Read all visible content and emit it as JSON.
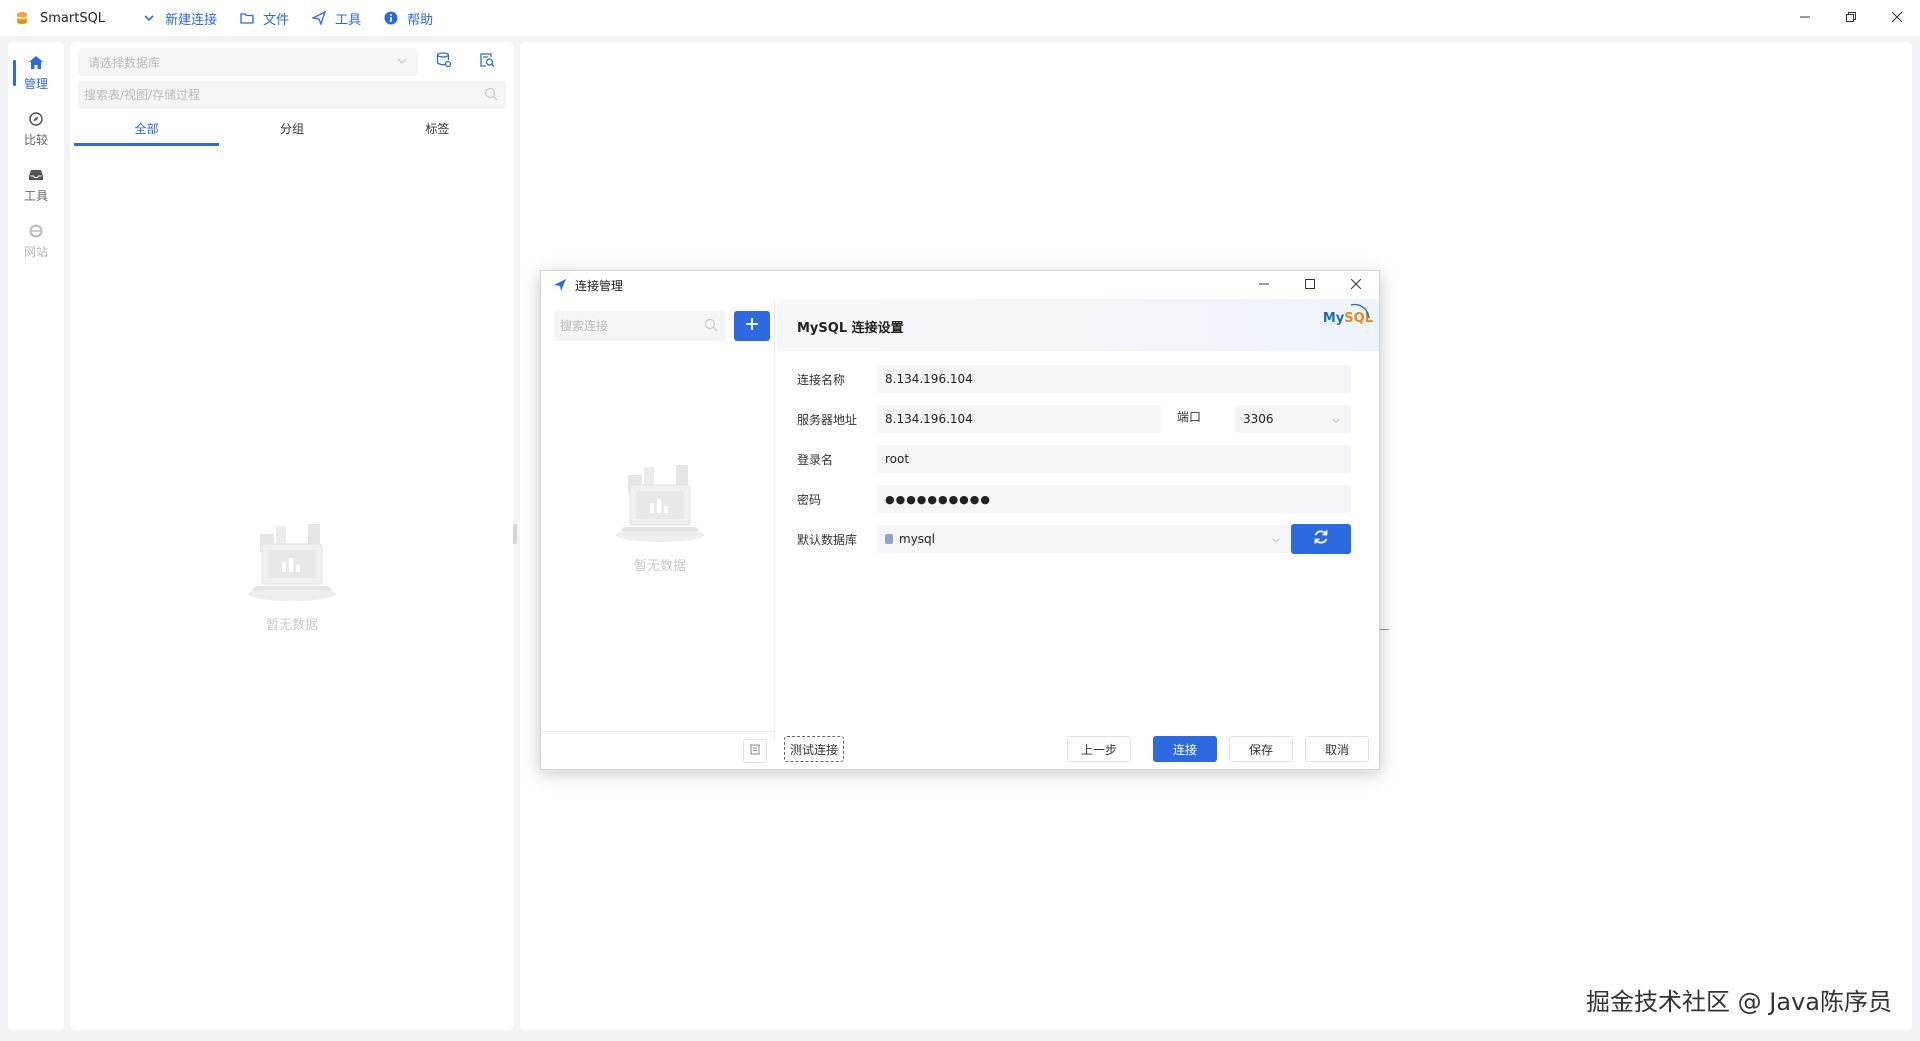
{
  "app": {
    "name": "SmartSQL",
    "menu": [
      {
        "label": "新建连接",
        "icon": "chevron-down-icon"
      },
      {
        "label": "文件",
        "icon": "folder-icon"
      },
      {
        "label": "工具",
        "icon": "send-icon"
      },
      {
        "label": "帮助",
        "icon": "info-icon"
      }
    ]
  },
  "leftnav": [
    {
      "label": "管理",
      "icon": "home-icon",
      "active": true
    },
    {
      "label": "比较",
      "icon": "compass-icon"
    },
    {
      "label": "工具",
      "icon": "inbox-icon"
    },
    {
      "label": "网站",
      "icon": "ie-icon",
      "disabled": true
    }
  ],
  "sidepanel": {
    "db_placeholder": "请选择数据库",
    "search_placeholder": "搜索表/视图/存储过程",
    "tabs": [
      "全部",
      "分组",
      "标签"
    ],
    "active_tab": "全部",
    "empty_text": "暂无数据"
  },
  "dialog": {
    "title": "连接管理",
    "search_placeholder": "搜索连接",
    "empty_text": "暂无数据",
    "header_title": "MySQL 连接设置",
    "logo_text_my": "My",
    "logo_text_sql": "SQL",
    "form": {
      "name_label": "连接名称",
      "name_value": "8.134.196.104",
      "host_label": "服务器地址",
      "host_value": "8.134.196.104",
      "port_label": "端口",
      "port_value": "3306",
      "user_label": "登录名",
      "user_value": "root",
      "password_label": "密码",
      "password_value": "●●●●●●●●●●",
      "db_label": "默认数据库",
      "db_value": "mysql"
    },
    "buttons": {
      "test": "测试连接",
      "prev": "上一步",
      "connect": "连接",
      "save": "保存",
      "cancel": "取消"
    }
  },
  "watermark": "掘金技术社区 @ Java陈序员",
  "colors": {
    "accent": "#2d6ae0",
    "background": "#f2f3f5",
    "panel": "#ffffff",
    "field": "#f4f5f7"
  }
}
